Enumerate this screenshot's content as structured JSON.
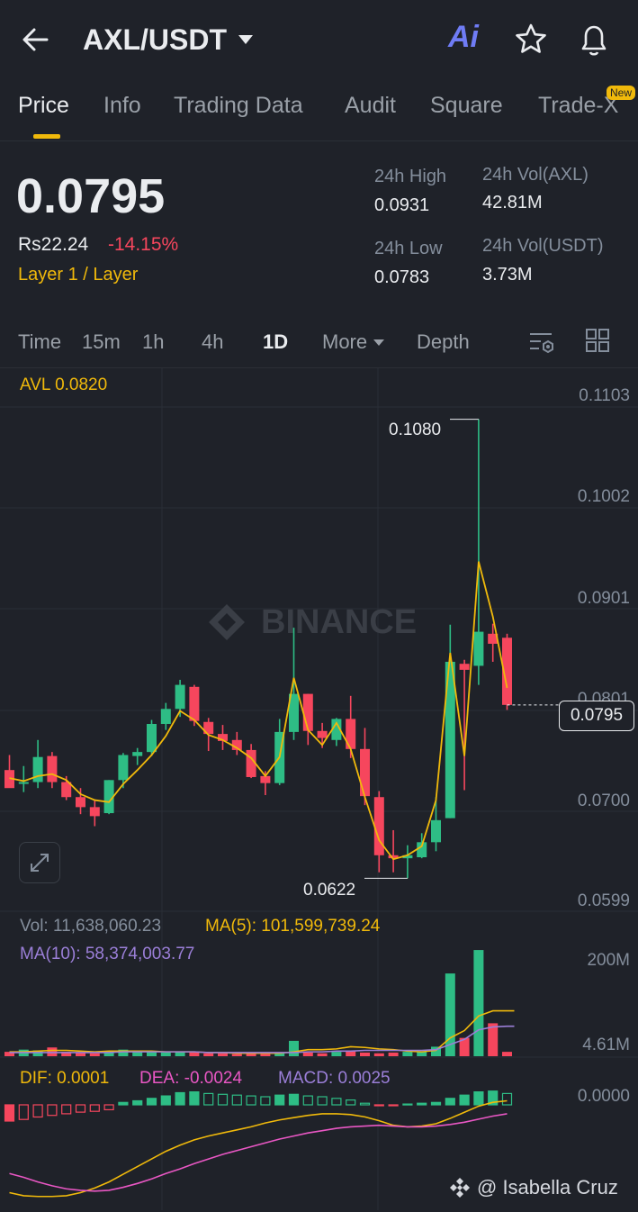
{
  "header": {
    "pair": "AXL/USDT",
    "ai_label": "Ai"
  },
  "tabs": [
    {
      "label": "Price"
    },
    {
      "label": "Info"
    },
    {
      "label": "Trading Data"
    },
    {
      "label": "Audit"
    },
    {
      "label": "Square"
    },
    {
      "label": "Trade-X",
      "badge": "New"
    }
  ],
  "price": {
    "last": "0.0795",
    "fiat": "Rs22.24",
    "change": "-14.15%",
    "category": "Layer 1 / Layer"
  },
  "stats": {
    "high_label": "24h High",
    "high": "0.0931",
    "low_label": "24h Low",
    "low": "0.0783",
    "vol_base_label": "24h Vol(AXL)",
    "vol_base": "42.81M",
    "vol_quote_label": "24h Vol(USDT)",
    "vol_quote": "3.73M"
  },
  "timeframes": {
    "time": "Time",
    "m15": "15m",
    "h1": "1h",
    "h4": "4h",
    "d1": "1D",
    "more": "More",
    "depth": "Depth"
  },
  "colors": {
    "up": "#2ebd85",
    "down": "#f6465d",
    "accent": "#f0b90b",
    "ma10": "#9b7fd8",
    "dea": "#e957c4",
    "bg": "#1f2229"
  },
  "chart_data": [
    {
      "type": "candlestick",
      "avl_label": "AVL 0.0820",
      "y_ticks": [
        "0.1103",
        "0.1002",
        "0.0901",
        "0.0801",
        "0.0700",
        "0.0599"
      ],
      "ylim": [
        0.0599,
        0.1103
      ],
      "annotations": {
        "high": "0.1080",
        "low": "0.0622",
        "current": "0.0795"
      },
      "watermark": "BINANCE",
      "candles": [
        {
          "o": 0.073,
          "h": 0.0745,
          "l": 0.0713,
          "c": 0.0712
        },
        {
          "o": 0.0718,
          "h": 0.0734,
          "l": 0.0708,
          "c": 0.0718
        },
        {
          "o": 0.0718,
          "h": 0.076,
          "l": 0.0712,
          "c": 0.0743
        },
        {
          "o": 0.0744,
          "h": 0.0748,
          "l": 0.0712,
          "c": 0.0718
        },
        {
          "o": 0.0718,
          "h": 0.0724,
          "l": 0.07,
          "c": 0.0703
        },
        {
          "o": 0.0703,
          "h": 0.0712,
          "l": 0.0686,
          "c": 0.0693
        },
        {
          "o": 0.0693,
          "h": 0.07,
          "l": 0.0674,
          "c": 0.0684
        },
        {
          "o": 0.0687,
          "h": 0.072,
          "l": 0.0686,
          "c": 0.072
        },
        {
          "o": 0.072,
          "h": 0.0747,
          "l": 0.0712,
          "c": 0.0745
        },
        {
          "o": 0.0744,
          "h": 0.0752,
          "l": 0.0735,
          "c": 0.0748
        },
        {
          "o": 0.0748,
          "h": 0.078,
          "l": 0.0744,
          "c": 0.0776
        },
        {
          "o": 0.0776,
          "h": 0.0797,
          "l": 0.077,
          "c": 0.0791
        },
        {
          "o": 0.0791,
          "h": 0.082,
          "l": 0.0783,
          "c": 0.0815
        },
        {
          "o": 0.0813,
          "h": 0.0815,
          "l": 0.0774,
          "c": 0.0779
        },
        {
          "o": 0.0778,
          "h": 0.0782,
          "l": 0.0749,
          "c": 0.0766
        },
        {
          "o": 0.0766,
          "h": 0.0775,
          "l": 0.075,
          "c": 0.0759
        },
        {
          "o": 0.076,
          "h": 0.0768,
          "l": 0.0745,
          "c": 0.075
        },
        {
          "o": 0.075,
          "h": 0.0756,
          "l": 0.0722,
          "c": 0.0723
        },
        {
          "o": 0.0724,
          "h": 0.0729,
          "l": 0.0705,
          "c": 0.0717
        },
        {
          "o": 0.0717,
          "h": 0.0781,
          "l": 0.0715,
          "c": 0.0768
        },
        {
          "o": 0.0768,
          "h": 0.0872,
          "l": 0.076,
          "c": 0.0806
        },
        {
          "o": 0.0806,
          "h": 0.0806,
          "l": 0.0755,
          "c": 0.0769
        },
        {
          "o": 0.0769,
          "h": 0.0777,
          "l": 0.0752,
          "c": 0.0762
        },
        {
          "o": 0.076,
          "h": 0.0782,
          "l": 0.0754,
          "c": 0.0781
        },
        {
          "o": 0.0781,
          "h": 0.0804,
          "l": 0.0742,
          "c": 0.0751
        },
        {
          "o": 0.0751,
          "h": 0.0772,
          "l": 0.0695,
          "c": 0.0704
        },
        {
          "o": 0.0703,
          "h": 0.0709,
          "l": 0.0628,
          "c": 0.0645
        },
        {
          "o": 0.0645,
          "h": 0.067,
          "l": 0.0628,
          "c": 0.0642
        },
        {
          "o": 0.0642,
          "h": 0.0655,
          "l": 0.0622,
          "c": 0.0645
        },
        {
          "o": 0.0643,
          "h": 0.0667,
          "l": 0.0642,
          "c": 0.0658
        },
        {
          "o": 0.0658,
          "h": 0.0703,
          "l": 0.0649,
          "c": 0.068
        },
        {
          "o": 0.0682,
          "h": 0.0875,
          "l": 0.0682,
          "c": 0.0838
        },
        {
          "o": 0.0836,
          "h": 0.084,
          "l": 0.071,
          "c": 0.083
        },
        {
          "o": 0.0834,
          "h": 0.108,
          "l": 0.0815,
          "c": 0.0868
        },
        {
          "o": 0.0866,
          "h": 0.0876,
          "l": 0.0838,
          "c": 0.0856
        },
        {
          "o": 0.0862,
          "h": 0.0866,
          "l": 0.079,
          "c": 0.0795
        }
      ],
      "ma": [
        0.0722,
        0.0719,
        0.0724,
        0.0726,
        0.072,
        0.0706,
        0.07,
        0.0698,
        0.0716,
        0.073,
        0.0745,
        0.0764,
        0.0789,
        0.078,
        0.0765,
        0.076,
        0.0752,
        0.0742,
        0.0724,
        0.0743,
        0.0822,
        0.077,
        0.0755,
        0.0777,
        0.0751,
        0.0703,
        0.066,
        0.0641,
        0.0645,
        0.0654,
        0.07,
        0.0847,
        0.0744,
        0.0938,
        0.0883,
        0.0812
      ]
    },
    {
      "type": "bar",
      "vol_label": "Vol: 11,638,060.23",
      "ma5_label": "MA(5): 101,599,739.24",
      "ma10_label": "MA(10): 58,374,003.77",
      "y_ticks": [
        "200M",
        "4.61M"
      ],
      "volumes": [
        6,
        9,
        8,
        12,
        6,
        5,
        4,
        7,
        9,
        6,
        7,
        5,
        6,
        5,
        4,
        4,
        3,
        4,
        3,
        5,
        21,
        5,
        4,
        6,
        7,
        5,
        4,
        5,
        6,
        6,
        13,
        113,
        25,
        145,
        45,
        6
      ],
      "ma5_vol": [
        6,
        6,
        7,
        8,
        8,
        7,
        6,
        7,
        7,
        7,
        7,
        6,
        6,
        6,
        5,
        5,
        4,
        4,
        4,
        4,
        6,
        9,
        9,
        10,
        13,
        12,
        10,
        9,
        7,
        6,
        8,
        25,
        35,
        55,
        62,
        62
      ],
      "ma10_vol": [
        5,
        5,
        5,
        5,
        5,
        5,
        5,
        5,
        6,
        6,
        6,
        6,
        6,
        6,
        5,
        5,
        5,
        5,
        5,
        5,
        5,
        6,
        6,
        7,
        7,
        8,
        8,
        8,
        8,
        8,
        9,
        16,
        23,
        36,
        40,
        41
      ]
    },
    {
      "type": "bar",
      "dif_label": "DIF: 0.0001",
      "dea_label": "DEA: -0.0024",
      "macd_label": "MACD: 0.0025",
      "y_ticks": [
        "0.0000"
      ],
      "hist": [
        -2.0,
        -1.8,
        -1.5,
        -1.3,
        -1.1,
        -0.9,
        -0.8,
        -0.6,
        0.3,
        0.5,
        0.8,
        1.1,
        1.5,
        1.6,
        1.4,
        1.3,
        1.2,
        1.1,
        1.0,
        1.2,
        1.3,
        1.1,
        1.0,
        0.8,
        0.6,
        0.2,
        -0.1,
        -0.1,
        0.1,
        0.2,
        0.3,
        0.8,
        1.2,
        1.6,
        1.7,
        1.4
      ],
      "dif": [
        -11,
        -11.4,
        -11.5,
        -11.5,
        -11.4,
        -11.0,
        -10.4,
        -9.6,
        -8.6,
        -7.6,
        -6.6,
        -5.6,
        -4.8,
        -4.1,
        -3.6,
        -3.2,
        -2.8,
        -2.4,
        -1.9,
        -1.5,
        -1.2,
        -0.9,
        -0.7,
        -0.7,
        -0.8,
        -1.1,
        -1.6,
        -2.2,
        -2.4,
        -2.3,
        -2.0,
        -1.3,
        -0.5,
        0.3,
        0.8,
        1.0
      ],
      "dea": [
        -8.5,
        -9.0,
        -9.6,
        -10.1,
        -10.5,
        -10.7,
        -10.8,
        -10.7,
        -10.3,
        -9.8,
        -9.2,
        -8.5,
        -7.9,
        -7.2,
        -6.6,
        -6.0,
        -5.5,
        -5.0,
        -4.5,
        -4.0,
        -3.6,
        -3.2,
        -2.9,
        -2.6,
        -2.4,
        -2.3,
        -2.2,
        -2.3,
        -2.4,
        -2.4,
        -2.3,
        -2.1,
        -1.8,
        -1.4,
        -1.0,
        -0.7
      ]
    }
  ],
  "footer": {
    "credit": "@ Isabella Cruz"
  }
}
